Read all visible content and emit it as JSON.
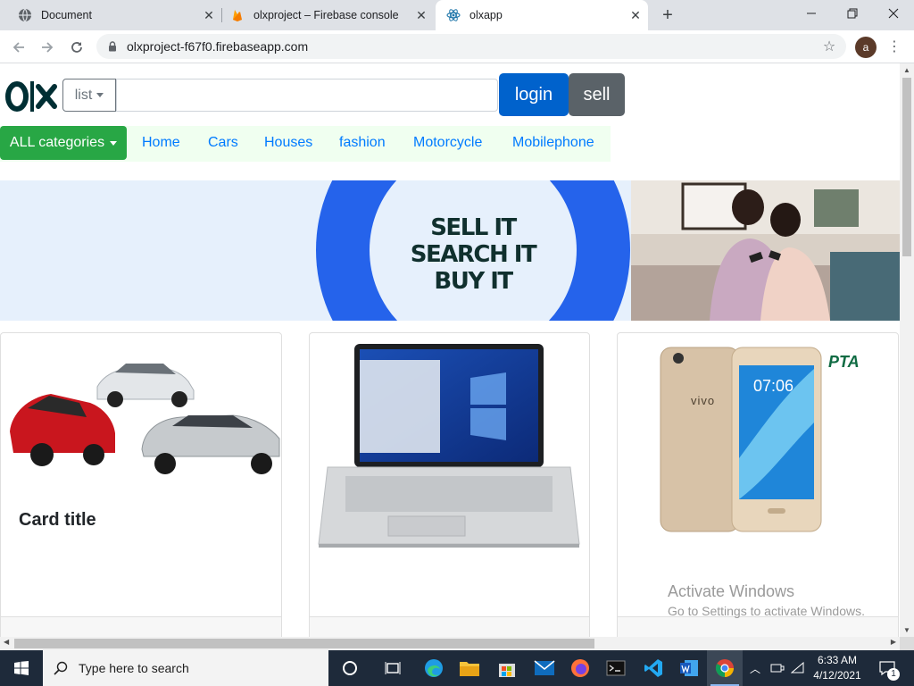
{
  "browser": {
    "tabs": [
      {
        "title": "Document"
      },
      {
        "title": "olxproject – Firebase console"
      },
      {
        "title": "olxapp"
      }
    ],
    "new_tab": "+",
    "address": "olxproject-f67f0.firebaseapp.com",
    "profile_initial": "a"
  },
  "header": {
    "list_label": "list",
    "search_value": "",
    "login_label": "login",
    "sell_label": "sell"
  },
  "categories": {
    "all_label": "ALL categories",
    "links": [
      "Home",
      "Cars",
      "Houses",
      "fashion",
      "Motorcycle",
      "Mobilephone"
    ]
  },
  "banner": {
    "lines": [
      "SELL IT",
      "SEARCH IT",
      "BUY IT"
    ]
  },
  "cards": [
    {
      "title": "Card title"
    },
    {
      "title": ""
    },
    {
      "title": ""
    }
  ],
  "phone_badge": "PTA",
  "phone_brand": "vivo",
  "phone_time": "07:06",
  "watermark": {
    "line1": "Activate Windows",
    "line2": "Go to Settings to activate Windows."
  },
  "taskbar": {
    "search_placeholder": "Type here to search",
    "time": "6:33 AM",
    "date": "4/12/2021",
    "notification_count": "1"
  },
  "colors": {
    "login": "#0062cc",
    "sell": "#5a6268",
    "all_categories": "#28a745",
    "link": "#007bff",
    "banner_ring": "#2563eb",
    "banner_text": "#10302e"
  }
}
